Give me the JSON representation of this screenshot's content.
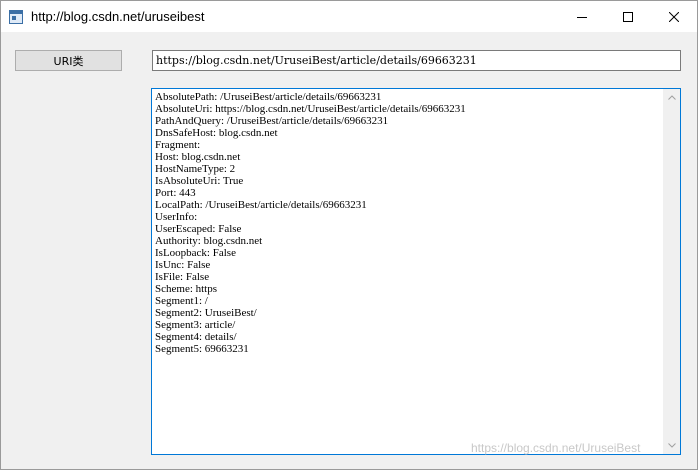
{
  "window": {
    "title": "http://blog.csdn.net/uruseibest",
    "icon": "winform-app-icon",
    "controls": [
      "minimize-icon",
      "maximize-icon",
      "close-icon"
    ]
  },
  "form": {
    "uri_button_label": "URI类",
    "url_value": "https://blog.csdn.net/UruseiBest/article/details/69663231"
  },
  "output": {
    "lines": [
      "AbsolutePath: /UruseiBest/article/details/69663231",
      "AbsoluteUri: https://blog.csdn.net/UruseiBest/article/details/69663231",
      "PathAndQuery: /UruseiBest/article/details/69663231",
      "DnsSafeHost: blog.csdn.net",
      "Fragment:",
      "Host: blog.csdn.net",
      "HostNameType: 2",
      "IsAbsoluteUri: True",
      "Port: 443",
      "LocalPath: /UruseiBest/article/details/69663231",
      "UserInfo:",
      "UserEscaped: False",
      "Authority: blog.csdn.net",
      "IsLoopback: False",
      "IsUnc: False",
      "IsFile: False",
      "Scheme: https",
      "Segment1: /",
      "Segment2: UruseiBest/",
      "Segment3: article/",
      "Segment4: details/",
      "Segment5: 69663231"
    ]
  },
  "watermark": "https://blog.csdn.net/UruseiBest",
  "colors": {
    "focus_border": "#0078d7",
    "window_bg": "#f0f0f0",
    "button_bg": "#e1e1e1"
  }
}
